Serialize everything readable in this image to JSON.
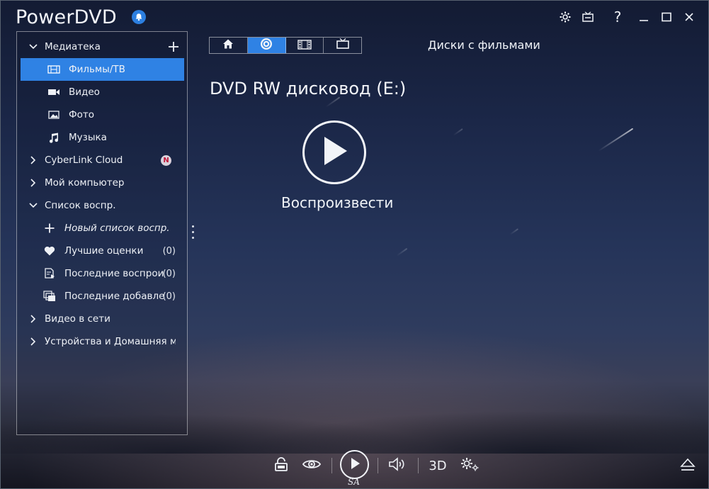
{
  "app": {
    "title": "PowerDVD"
  },
  "sidebar": {
    "library": {
      "label": "Медиатека",
      "add_icon": "plus-icon"
    },
    "library_items": [
      {
        "label": "Фильмы/ТВ",
        "icon": "film-tv-icon",
        "selected": true
      },
      {
        "label": "Видео",
        "icon": "video-camera-icon"
      },
      {
        "label": "Фото",
        "icon": "photo-icon"
      },
      {
        "label": "Музыка",
        "icon": "music-note-icon"
      }
    ],
    "cloud": {
      "label": "CyberLink Cloud",
      "badge": "N"
    },
    "my_computer": {
      "label": "Мой компьютер"
    },
    "playlists": {
      "label": "Список воспр."
    },
    "playlist_items": [
      {
        "label": "Новый список воспр.",
        "icon": "plus-icon",
        "count": ""
      },
      {
        "label": "Лучшие оценки",
        "icon": "heart-icon",
        "count": "(0)"
      },
      {
        "label": "Последние воспроизведенные",
        "icon": "recent-played-icon",
        "count": "(0)"
      },
      {
        "label": "Последние добавленные",
        "icon": "recent-added-icon",
        "count": "(0)"
      }
    ],
    "online_video": {
      "label": "Видео в сети"
    },
    "devices": {
      "label": "Устройства и Домашняя медиасеть"
    }
  },
  "tabs": [
    {
      "icon": "home-icon"
    },
    {
      "icon": "disc-icon",
      "active": true
    },
    {
      "icon": "film-strip-icon"
    },
    {
      "icon": "tv-icon"
    }
  ],
  "main": {
    "section_title": "Диски с фильмами",
    "drive_title": "DVD RW дисковод (E:)",
    "play_label": "Воспроизвести"
  },
  "bottom": {
    "threed_label": "3D",
    "sa_label": "SA"
  },
  "colors": {
    "accent": "#2f82e4",
    "badge_bg": "#d9d2dc",
    "badge_fg": "#c0173b"
  }
}
